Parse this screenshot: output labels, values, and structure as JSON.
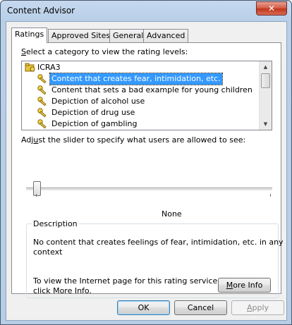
{
  "window": {
    "title": "Content Advisor",
    "close_label": "✕"
  },
  "tabs": [
    {
      "label": "Ratings"
    },
    {
      "label": "Approved Sites"
    },
    {
      "label": "General"
    },
    {
      "label": "Advanced"
    }
  ],
  "ratings": {
    "select_prompt_prefix": "S",
    "select_prompt_rest": "elect a category to view the rating levels:",
    "root": "ICRA3",
    "categories": [
      "Content that creates fear, intimidation, etc.",
      "Content that sets a bad example for young children",
      "Depiction of alcohol use",
      "Depiction of drug use",
      "Depiction of gambling"
    ],
    "selected_index": 0,
    "slider_prompt_prefix": "Adj",
    "slider_prompt_u": "u",
    "slider_prompt_rest": "st the slider to specify what users are allowed to see:",
    "slider_value_label": "None",
    "slider_level": 0,
    "description_label": "Description",
    "description_text_line1": "No content that creates feelings of fear, intimidation, etc. in any",
    "description_text_line2": "context",
    "info_text_line1": "To view the Internet page for this rating service,",
    "info_text_line2": "click More Info.",
    "more_info_u": "M",
    "more_info_rest": "ore Info"
  },
  "buttons": {
    "ok": "OK",
    "cancel": "Cancel",
    "apply_u": "A",
    "apply_rest": "pply"
  },
  "icons": {
    "root": "ratings-folder-icon",
    "category": "key-icon"
  },
  "colors": {
    "selection": "#3399ff",
    "titlebar": "#c5d8ee",
    "close": "#c0341c"
  }
}
